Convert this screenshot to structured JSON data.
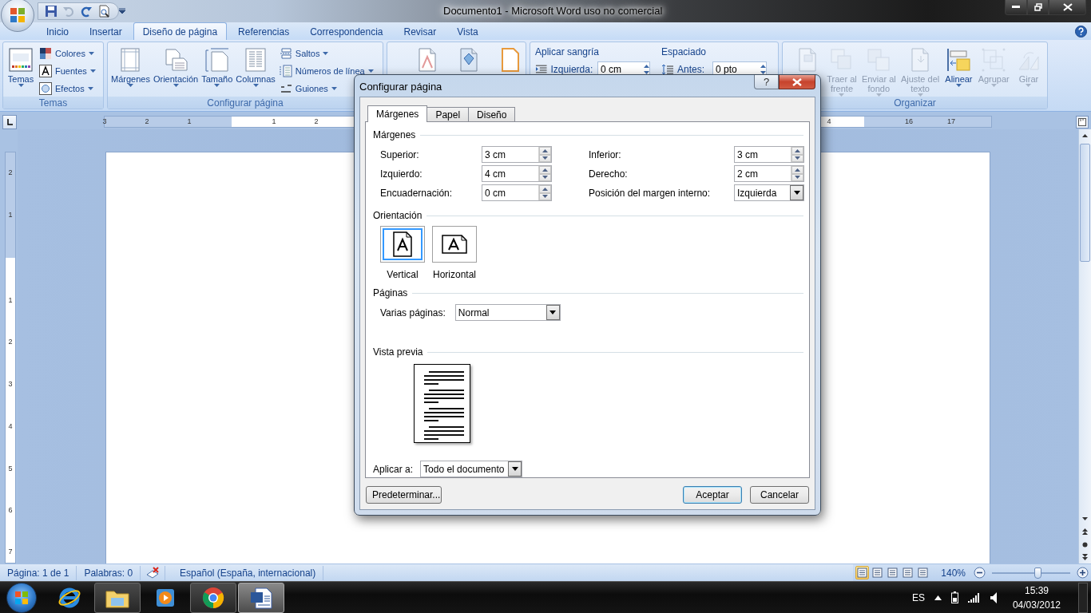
{
  "window": {
    "title": "Documento1 - Microsoft Word uso no comercial"
  },
  "ribbon_tabs": [
    {
      "label": "Inicio",
      "selected": false
    },
    {
      "label": "Insertar",
      "selected": false
    },
    {
      "label": "Diseño de página",
      "selected": true
    },
    {
      "label": "Referencias",
      "selected": false
    },
    {
      "label": "Correspondencia",
      "selected": false
    },
    {
      "label": "Revisar",
      "selected": false
    },
    {
      "label": "Vista",
      "selected": false
    }
  ],
  "ribbon_groups": [
    {
      "kind": "themes",
      "title": "Temas",
      "large": [
        {
          "lines": [
            "Temas"
          ],
          "disabled": false
        }
      ],
      "small": [
        "Colores",
        "Fuentes",
        "Efectos"
      ]
    },
    {
      "kind": "page_setup",
      "title": "Configurar página",
      "large": [
        {
          "lines": [
            "Márgenes"
          ],
          "disabled": false
        },
        {
          "lines": [
            "Orientación"
          ],
          "disabled": false
        },
        {
          "lines": [
            "Tamaño"
          ],
          "disabled": false
        },
        {
          "lines": [
            "Columnas"
          ],
          "disabled": false
        }
      ],
      "small": [
        "Saltos",
        "Números de línea",
        "Guiones"
      ]
    },
    {
      "kind": "page_background"
    },
    {
      "kind": "paragraph",
      "fields": [
        {
          "heading": "Aplicar sangría",
          "label": "Izquierda:",
          "value": "0 cm"
        },
        {
          "heading": "Espaciado",
          "label": "Antes:",
          "value": "0 pto"
        }
      ]
    },
    {
      "kind": "arrange",
      "title": "Organizar",
      "large": [
        {
          "disabled": true
        },
        {
          "lines": [
            "Traer al",
            "frente"
          ],
          "disabled": true
        },
        {
          "lines": [
            "Enviar al",
            "fondo"
          ],
          "disabled": true
        },
        {
          "lines": [
            "Ajuste del",
            "texto"
          ],
          "disabled": true
        },
        {
          "lines": [
            "Alinear"
          ],
          "disabled": false
        },
        {
          "lines": [
            "Agrupar"
          ],
          "disabled": true
        },
        {
          "lines": [
            "Girar"
          ],
          "disabled": true
        }
      ]
    }
  ],
  "horizontal_ruler": {
    "labels": [
      "3",
      "2",
      "1",
      "1",
      "2",
      "4",
      "16",
      "17"
    ]
  },
  "vertical_ruler": {
    "labels": [
      "2",
      "1",
      "1",
      "2",
      "3",
      "4",
      "5",
      "6",
      "7"
    ]
  },
  "dialog": {
    "title": "Configurar página",
    "help_button": "?",
    "tabs": [
      {
        "label": "Márgenes",
        "selected": true
      },
      {
        "label": "Papel",
        "selected": false
      },
      {
        "label": "Diseño",
        "selected": false
      }
    ],
    "margins": {
      "heading": "Márgenes",
      "fields": [
        {
          "label": "Superior:",
          "value": "3 cm",
          "kind": "spin"
        },
        {
          "label": "Inferior:",
          "value": "3 cm",
          "kind": "spin"
        },
        {
          "label": "Izquierdo:",
          "value": "4 cm",
          "kind": "spin"
        },
        {
          "label": "Derecho:",
          "value": "2 cm",
          "kind": "spin"
        },
        {
          "label": "Encuadernación:",
          "value": "0 cm",
          "kind": "spin"
        },
        {
          "label": "Posición del margen interno:",
          "value": "Izquierda",
          "kind": "dropdown"
        }
      ]
    },
    "orientation": {
      "heading": "Orientación",
      "options": [
        {
          "label": "Vertical",
          "selected": true
        },
        {
          "label": "Horizontal",
          "selected": false
        }
      ]
    },
    "pages": {
      "heading": "Páginas",
      "label": "Varias páginas:",
      "value": "Normal"
    },
    "preview": {
      "heading": "Vista previa"
    },
    "apply_to": {
      "label": "Aplicar a:",
      "value": "Todo el documento"
    },
    "buttons": [
      {
        "label": "Predeterminar...",
        "default": false
      },
      {
        "label": "Aceptar",
        "default": true
      },
      {
        "label": "Cancelar",
        "default": false
      }
    ]
  },
  "status_bar": {
    "page": "Página: 1 de 1",
    "words": "Palabras: 0",
    "language": "Español (España, internacional)",
    "views": [
      {
        "selected": true
      },
      {
        "selected": false
      },
      {
        "selected": false
      },
      {
        "selected": false
      },
      {
        "selected": false
      }
    ],
    "zoom": "140%",
    "zoom_slider": {
      "level": 0.58
    }
  },
  "taskbar": {
    "apps": [
      {
        "running": false,
        "active": false
      },
      {
        "running": true,
        "active": false
      },
      {
        "running": false,
        "active": false
      },
      {
        "running": true,
        "active": false
      },
      {
        "running": true,
        "active": true
      }
    ],
    "tray": {
      "language": "ES",
      "time": "15:39",
      "date": "04/03/2012"
    }
  }
}
